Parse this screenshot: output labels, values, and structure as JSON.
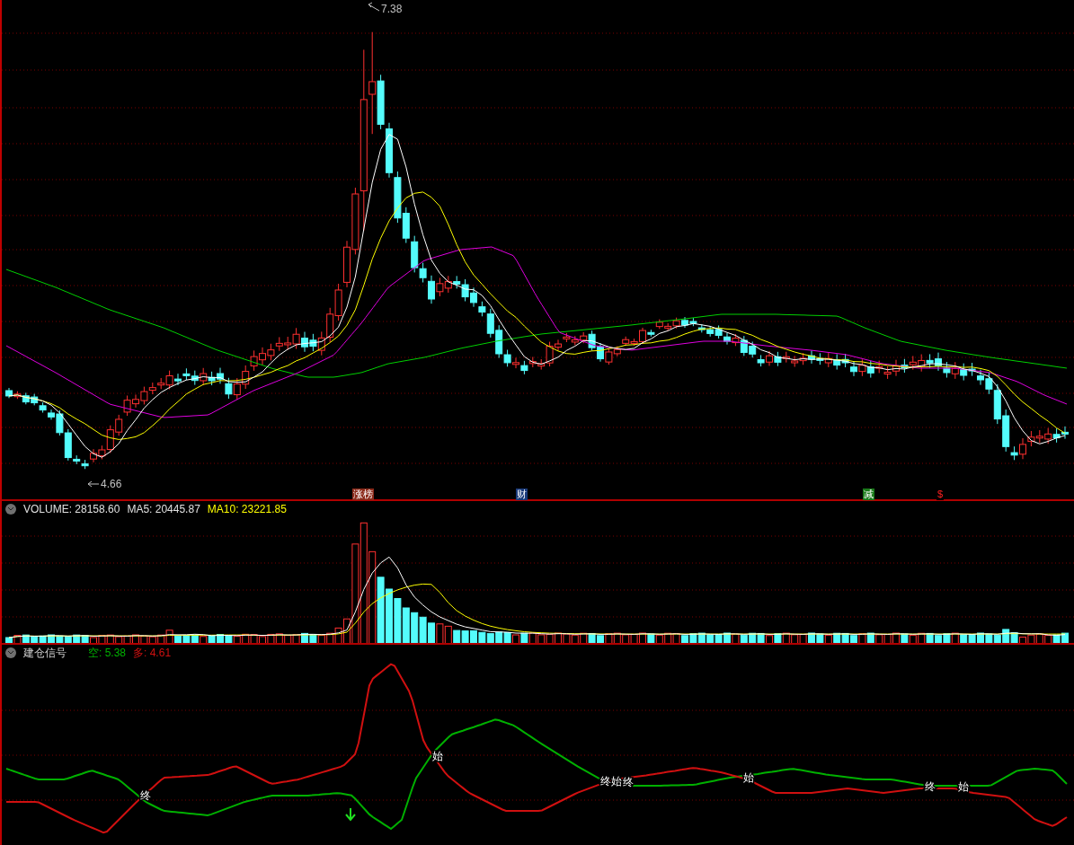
{
  "price_chart": {
    "high_label": "7.38",
    "low_label": "4.66",
    "markers": [
      {
        "text": "涨榜",
        "color": "#8b2a1a"
      },
      {
        "text": "财",
        "color": "#1a3a7a"
      },
      {
        "text": "减",
        "color": "#1a7a1a"
      },
      {
        "text": "$",
        "color": "#000000"
      }
    ]
  },
  "volume_panel": {
    "readings": [
      {
        "text": "VOLUME: 28158.60",
        "color": "#e0e0e0"
      },
      {
        "text": "MA5: 20445.87",
        "color": "#e0e0e0"
      },
      {
        "text": "MA10: 23221.85",
        "color": "#ffff00"
      }
    ]
  },
  "signal_panel": {
    "title": "建仓信号",
    "readings": [
      {
        "label": "空:",
        "value": "5.38",
        "color": "#00b000"
      },
      {
        "label": "多:",
        "value": "4.61",
        "color": "#d01010"
      }
    ],
    "labels": [
      "终",
      "始",
      "终始",
      "终",
      "始",
      "终",
      "始"
    ]
  }
}
